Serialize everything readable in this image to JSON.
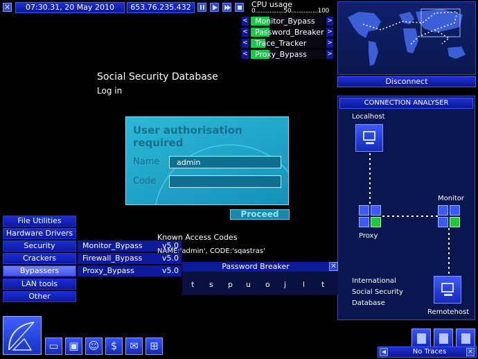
{
  "topbar": {
    "datetime": "07:30.31, 20 May 2010",
    "ip": "653.76.235.432"
  },
  "cpu": {
    "title": "CPU usage",
    "scale": "0................50...............100",
    "programs": [
      {
        "label": "Monitor_Bypass",
        "progress": 0.25
      },
      {
        "label": "Password_Breaker",
        "progress": 0.25
      },
      {
        "label": "Trace_Tracker",
        "progress": 0.2
      },
      {
        "label": "Proxy_Bypass",
        "progress": 0.25
      }
    ]
  },
  "map": {
    "disconnect_label": "Disconnect"
  },
  "page": {
    "title": "Social Security Database",
    "subtitle": "Log in"
  },
  "login": {
    "heading": "User authorisation required",
    "name_label": "Name",
    "name_value": "admin",
    "code_label": "Code",
    "code_value": "",
    "proceed_label": "Proceed"
  },
  "analyser": {
    "title": "CONNECTION ANALYSER",
    "localhost": "Localhost",
    "proxy": "Proxy",
    "monitor": "Monitor",
    "target_line1": "International",
    "target_line2": "Social Security",
    "target_line3": "Database",
    "remotehost": "Remotehost"
  },
  "menu": {
    "items": [
      "File Utilities",
      "Hardware Drivers",
      "Security",
      "Crackers",
      "Bypassers",
      "LAN tools",
      "Other"
    ],
    "active": "Bypassers",
    "submenu": [
      {
        "label": "Monitor_Bypass",
        "version": "v5.0"
      },
      {
        "label": "Firewall_Bypass",
        "version": "v5.0"
      },
      {
        "label": "Proxy_Bypass",
        "version": "v5.0"
      }
    ]
  },
  "codes": {
    "title": "Known Access Codes",
    "line": "NAME:'admin', CODE:'sqastras'"
  },
  "password_breaker": {
    "title": "Password Breaker",
    "letters": [
      "t",
      "s",
      "p",
      "u",
      "o",
      "j",
      "l",
      "t"
    ]
  },
  "traces": {
    "label": "No Traces"
  },
  "colors": {
    "panel_blue": "#0d1a9c",
    "login_cyan": "#1fa7c9",
    "progress_green": "#18c84a"
  }
}
